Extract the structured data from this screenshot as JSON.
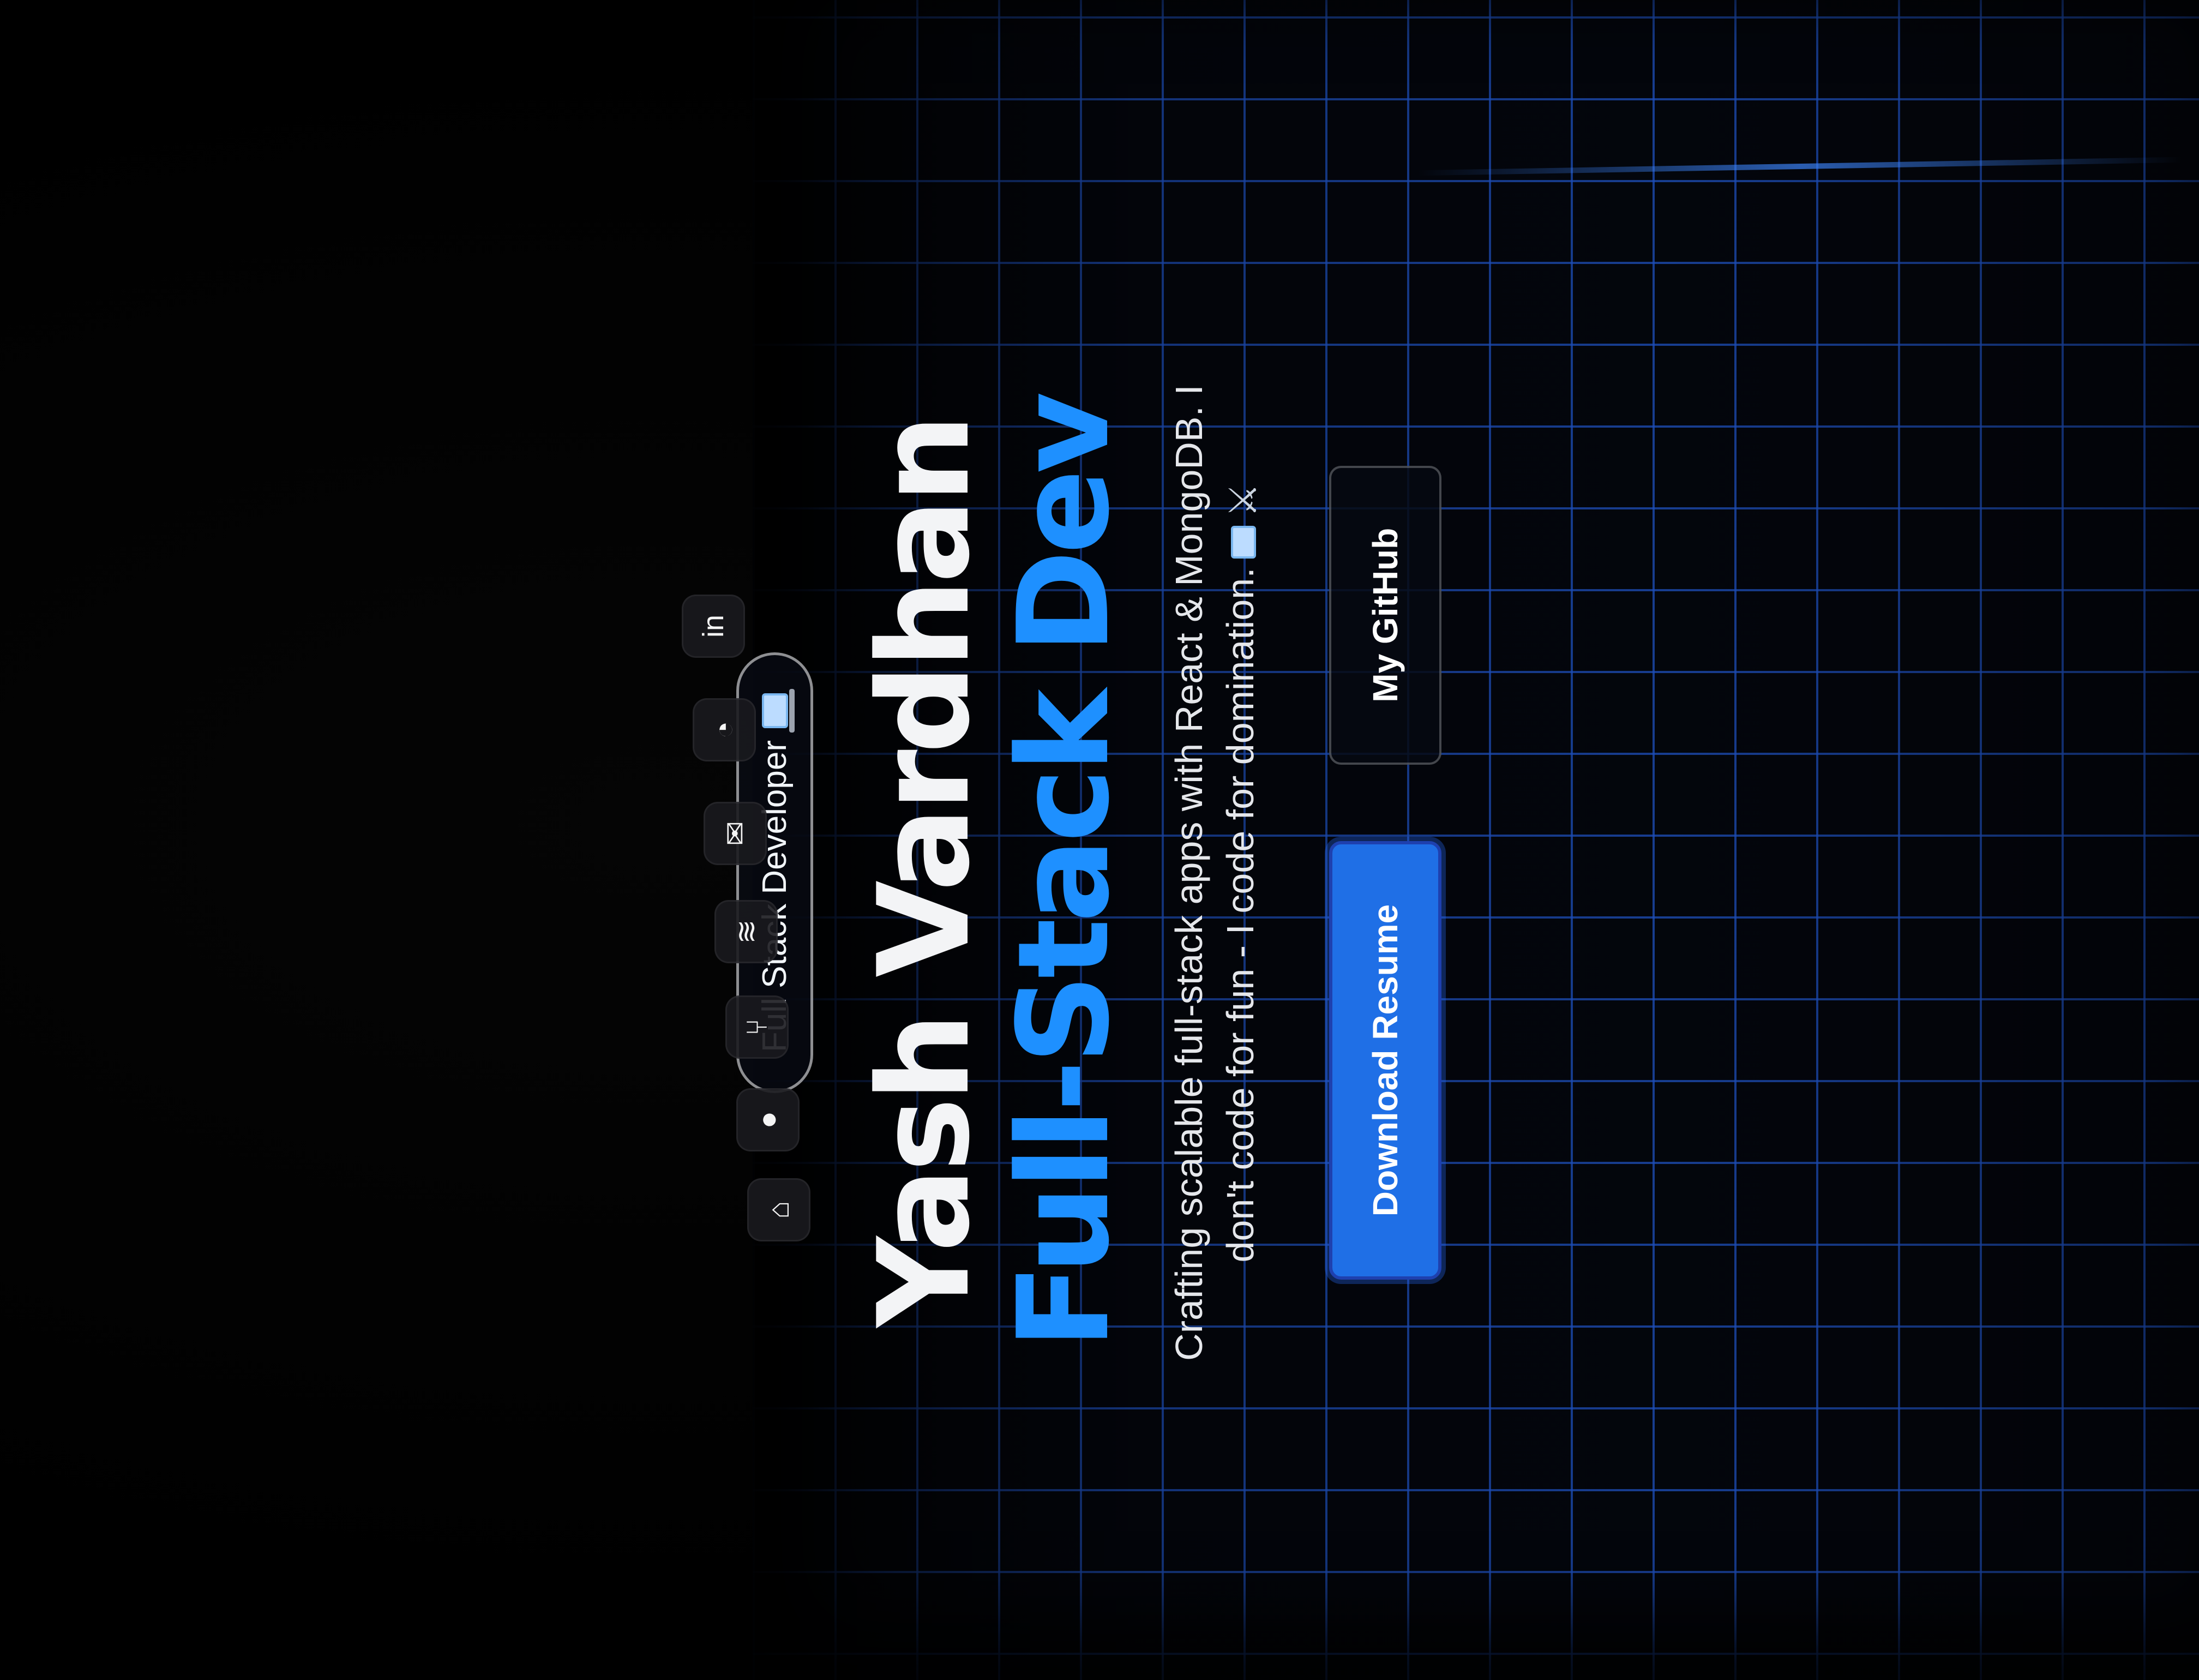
{
  "hero": {
    "badge_label": "Full Stack Developer",
    "badge_icon": "laptop-icon",
    "name": "Yash Vardhan",
    "role": "Full-Stack Dev",
    "tagline": "Crafting scalable full-stack apps with React & MongoDB. I don't code for fun - I code for domination.",
    "tagline_icons": [
      "laptop-icon",
      "crossed-swords-icon"
    ]
  },
  "actions": {
    "primary_label": "Download Resume",
    "secondary_label": "My GitHub"
  },
  "dock": {
    "items": [
      {
        "name": "linkedin-icon",
        "glyph": "in"
      },
      {
        "name": "github-icon",
        "glyph": "◔"
      },
      {
        "name": "mail-icon",
        "glyph": "✉"
      },
      {
        "name": "stack-icon",
        "glyph": "≋"
      },
      {
        "name": "projects-icon",
        "glyph": "⑂"
      },
      {
        "name": "user-icon",
        "glyph": "●"
      },
      {
        "name": "home-icon",
        "glyph": "⌂"
      }
    ]
  },
  "colors": {
    "accent": "#1e90ff",
    "grid": "#2563eb",
    "background": "#04070f",
    "primary_button": "#1f6fe6"
  }
}
